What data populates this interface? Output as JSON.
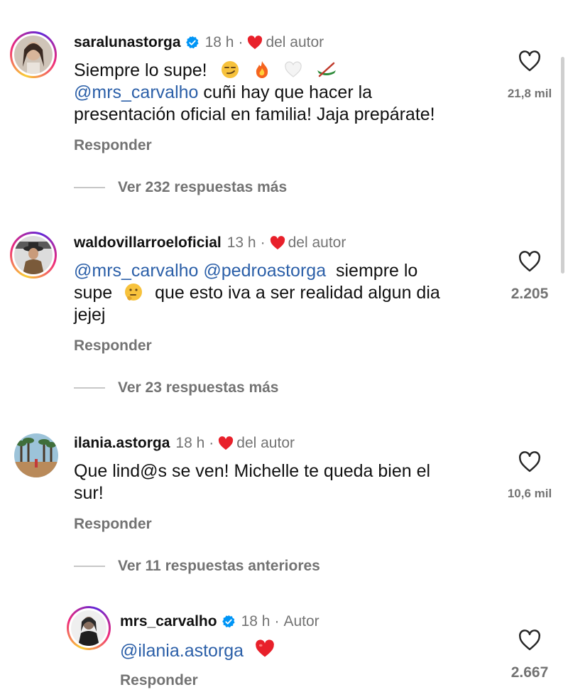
{
  "comments": [
    {
      "username": "saralunastorga",
      "verified": true,
      "time": "18 h",
      "author_liked_label": "del autor",
      "line1": "Siempre lo supe!",
      "mention": "@mrs_carvalho",
      "line2_rest": " cuñi hay que hacer la",
      "line3": "presentación oficial en familia! Jaja prepárate!",
      "emojis": [
        "smirk-emoji",
        "fire-emoji",
        "white-heart-emoji",
        "canoe-emoji"
      ],
      "reply_label": "Responder",
      "likes": "21,8 mil",
      "more_replies": "Ver 232 respuestas más"
    },
    {
      "username": "waldovillarroeloficial",
      "verified": false,
      "time": "13 h",
      "author_liked_label": "del autor",
      "mention1": "@mrs_carvalho",
      "mention2": "@pedroastorga",
      "line1_rest": "  siempre lo",
      "line2_a": "supe",
      "line2_b": "que esto iva a ser realidad algun dia",
      "line3": "jejej",
      "emojis": [
        "thinking-emoji"
      ],
      "reply_label": "Responder",
      "likes": "2.205",
      "more_replies": "Ver 23 respuestas más"
    },
    {
      "username": "ilania.astorga",
      "verified": false,
      "time": "18 h",
      "author_liked_label": "del autor",
      "line1": "Que lind@s se ven! Michelle te queda bien el",
      "line2": "sur!",
      "reply_label": "Responder",
      "likes": "10,6 mil",
      "more_replies": "Ver 11 respuestas anteriores"
    },
    {
      "username": "mrs_carvalho",
      "verified": true,
      "time": "18 h",
      "author_label": "Autor",
      "mention": "@ilania.astorga",
      "emojis": [
        "red-heart-emoji"
      ],
      "reply_label": "Responder",
      "likes": "2.667"
    }
  ],
  "colors": {
    "mention": "#2b5fa8",
    "secondary_text": "#737373",
    "heart": "#e8202a",
    "verified": "#0095f6"
  }
}
